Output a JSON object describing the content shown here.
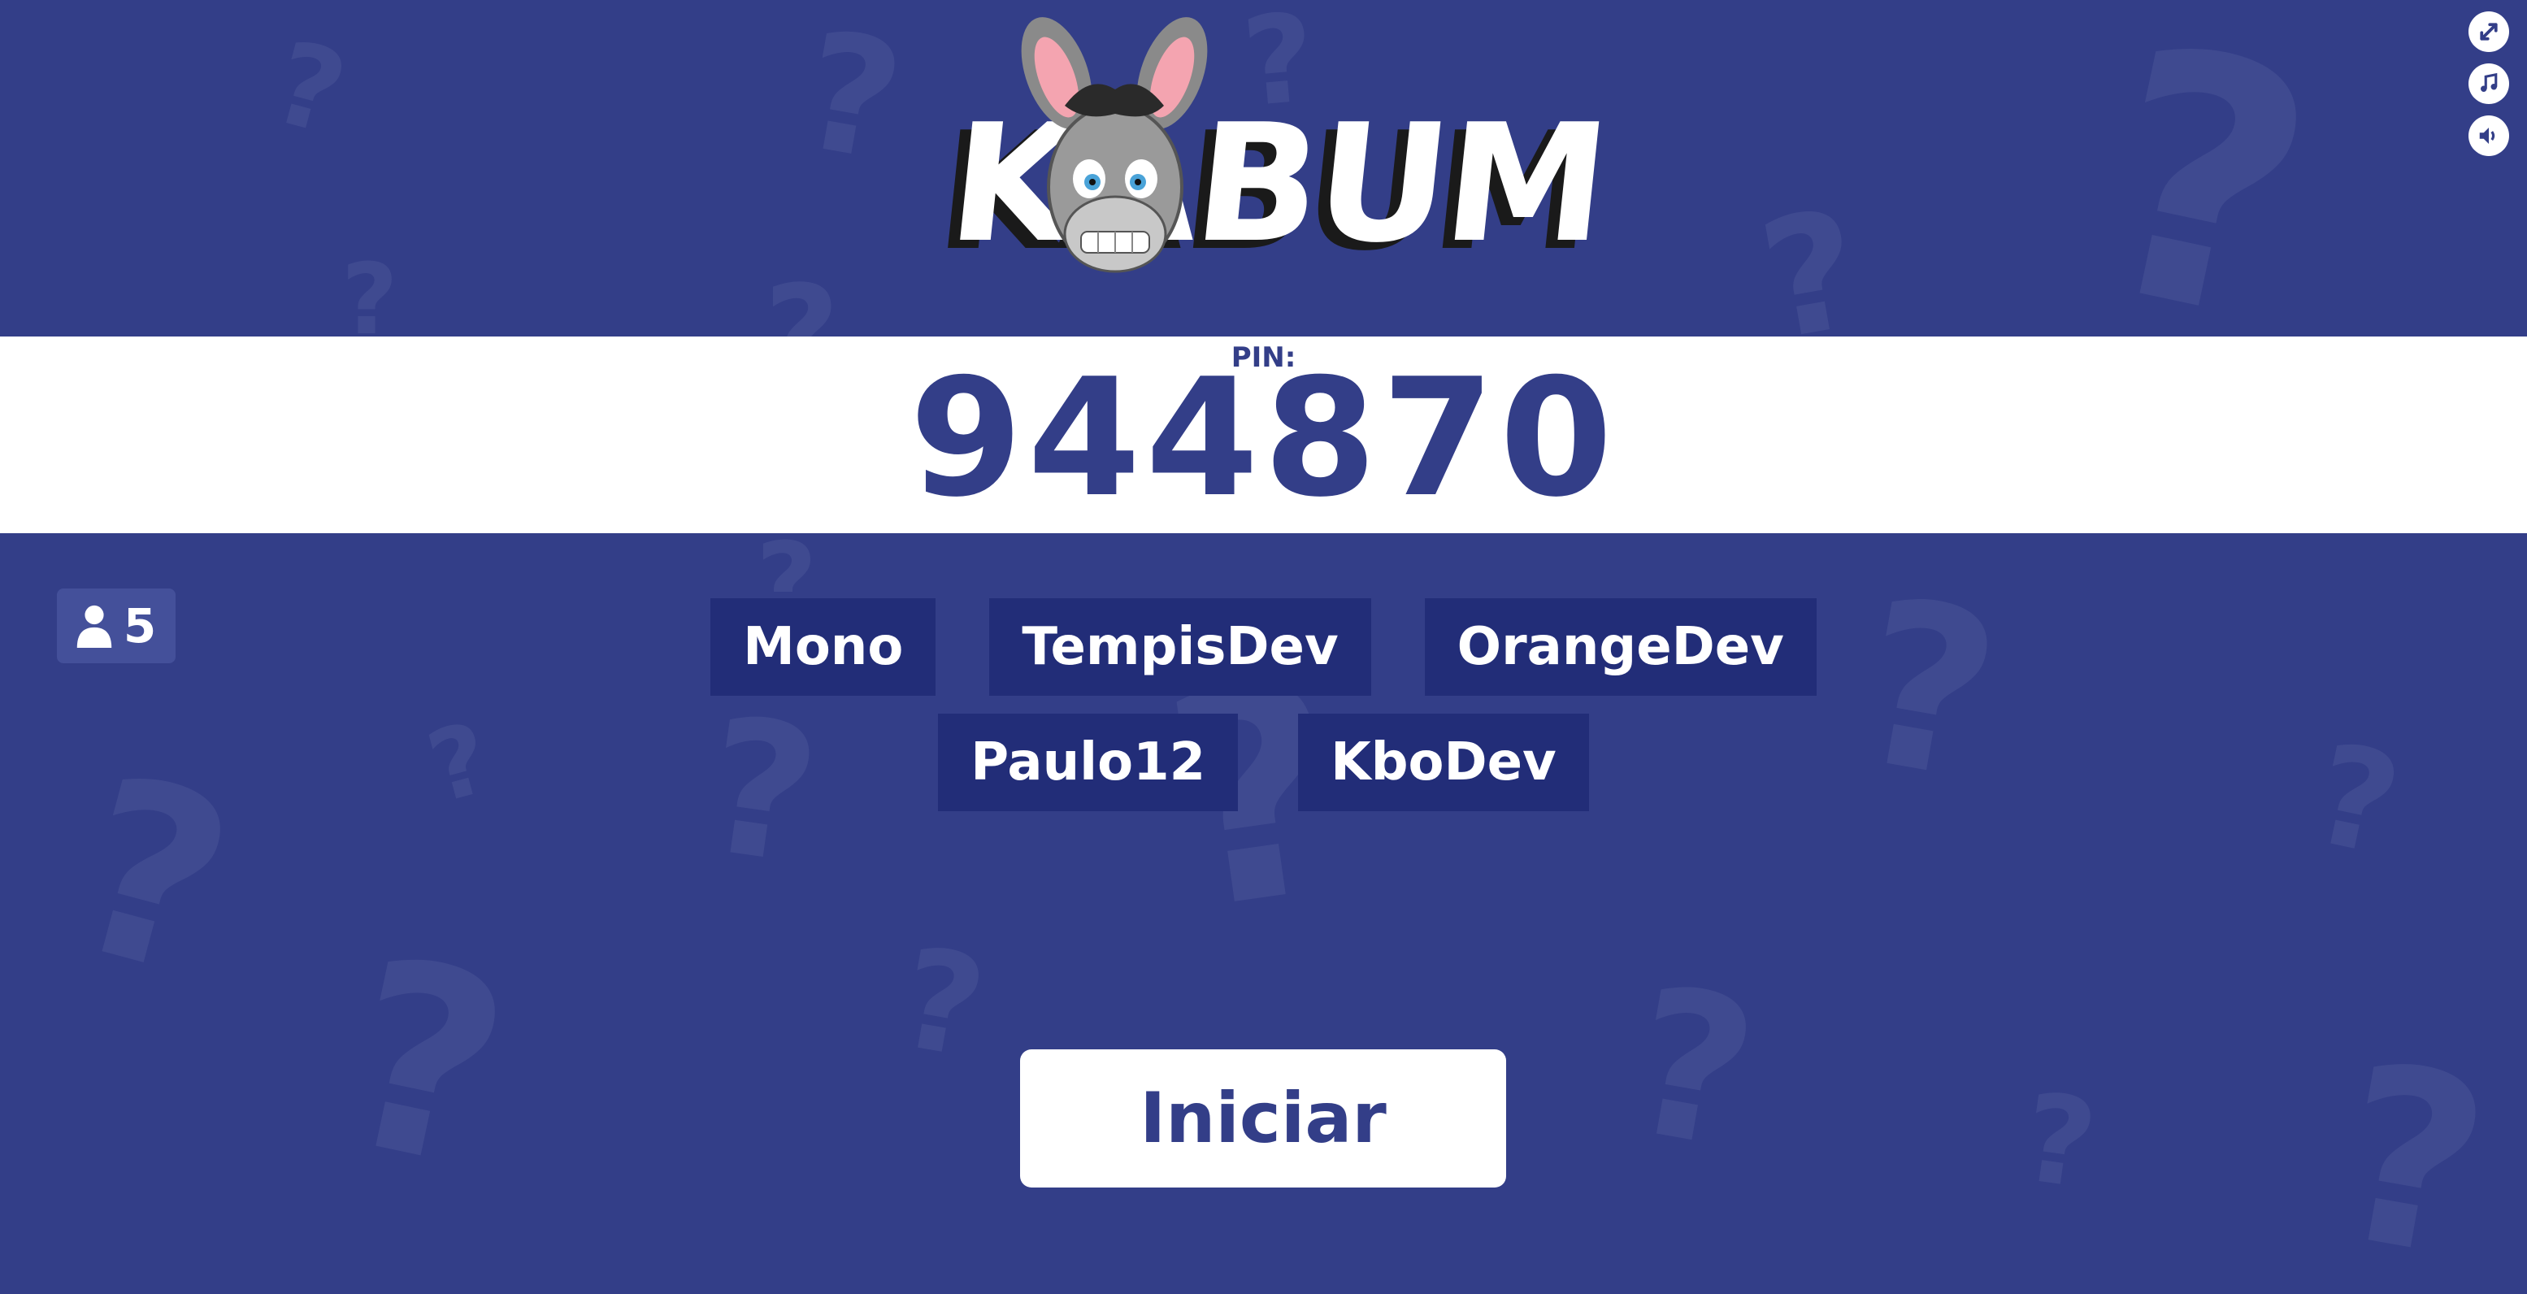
{
  "app": {
    "logo_text": "KABUM"
  },
  "controls": [
    {
      "icon": "fullscreen-icon"
    },
    {
      "icon": "music-icon"
    },
    {
      "icon": "volume-icon"
    }
  ],
  "pin": {
    "label": "PIN:",
    "value": "944870"
  },
  "player_count": {
    "icon": "user-icon",
    "value": "5"
  },
  "players": {
    "row1": [
      "Mono",
      "TempisDev",
      "OrangeDev"
    ],
    "row2": [
      "Paulo12",
      "KboDev"
    ]
  },
  "start_button": {
    "label": "Iniciar"
  },
  "colors": {
    "background": "#333e88",
    "player_tag": "#222d78",
    "accent_text": "#333e88",
    "white": "#ffffff"
  }
}
